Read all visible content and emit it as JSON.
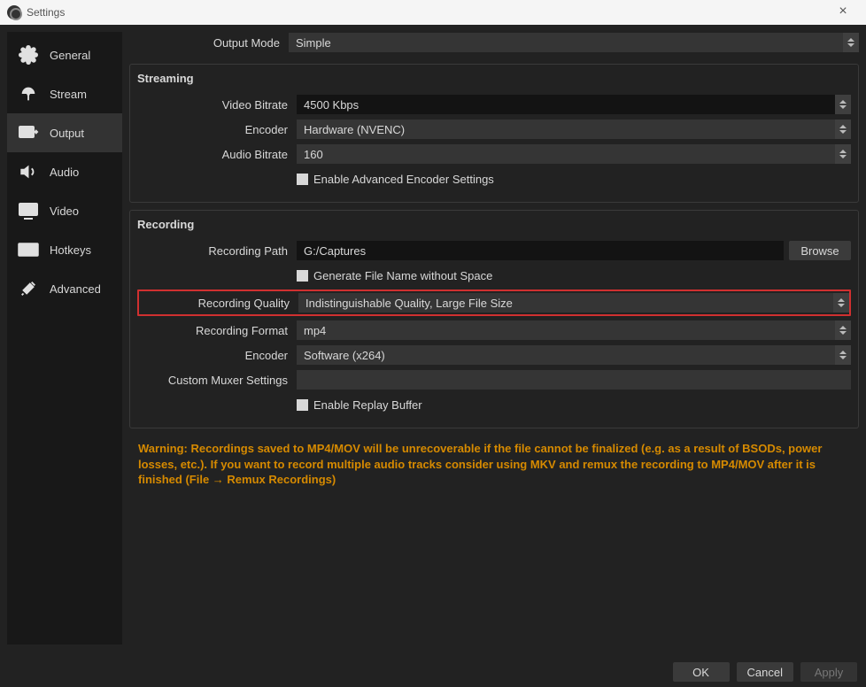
{
  "window": {
    "title": "Settings"
  },
  "sidebar": {
    "items": [
      {
        "label": "General"
      },
      {
        "label": "Stream"
      },
      {
        "label": "Output"
      },
      {
        "label": "Audio"
      },
      {
        "label": "Video"
      },
      {
        "label": "Hotkeys"
      },
      {
        "label": "Advanced"
      }
    ]
  },
  "output": {
    "mode_label": "Output Mode",
    "mode_value": "Simple"
  },
  "streaming": {
    "title": "Streaming",
    "video_bitrate_label": "Video Bitrate",
    "video_bitrate_value": "4500 Kbps",
    "encoder_label": "Encoder",
    "encoder_value": "Hardware (NVENC)",
    "audio_bitrate_label": "Audio Bitrate",
    "audio_bitrate_value": "160",
    "advanced_checkbox_label": "Enable Advanced Encoder Settings"
  },
  "recording": {
    "title": "Recording",
    "path_label": "Recording Path",
    "path_value": "G:/Captures",
    "browse_label": "Browse",
    "gen_filename_label": "Generate File Name without Space",
    "quality_label": "Recording Quality",
    "quality_value": "Indistinguishable Quality, Large File Size",
    "format_label": "Recording Format",
    "format_value": "mp4",
    "encoder_label": "Encoder",
    "encoder_value": "Software (x264)",
    "muxer_label": "Custom Muxer Settings",
    "muxer_value": "",
    "replay_buffer_label": "Enable Replay Buffer"
  },
  "warning_text": "Warning: Recordings saved to MP4/MOV will be unrecoverable if the file cannot be finalized (e.g. as a result of BSODs, power losses, etc.). If you want to record multiple audio tracks consider using MKV and remux the recording to MP4/MOV after it is finished (File → Remux Recordings)",
  "buttons": {
    "ok": "OK",
    "cancel": "Cancel",
    "apply": "Apply"
  }
}
